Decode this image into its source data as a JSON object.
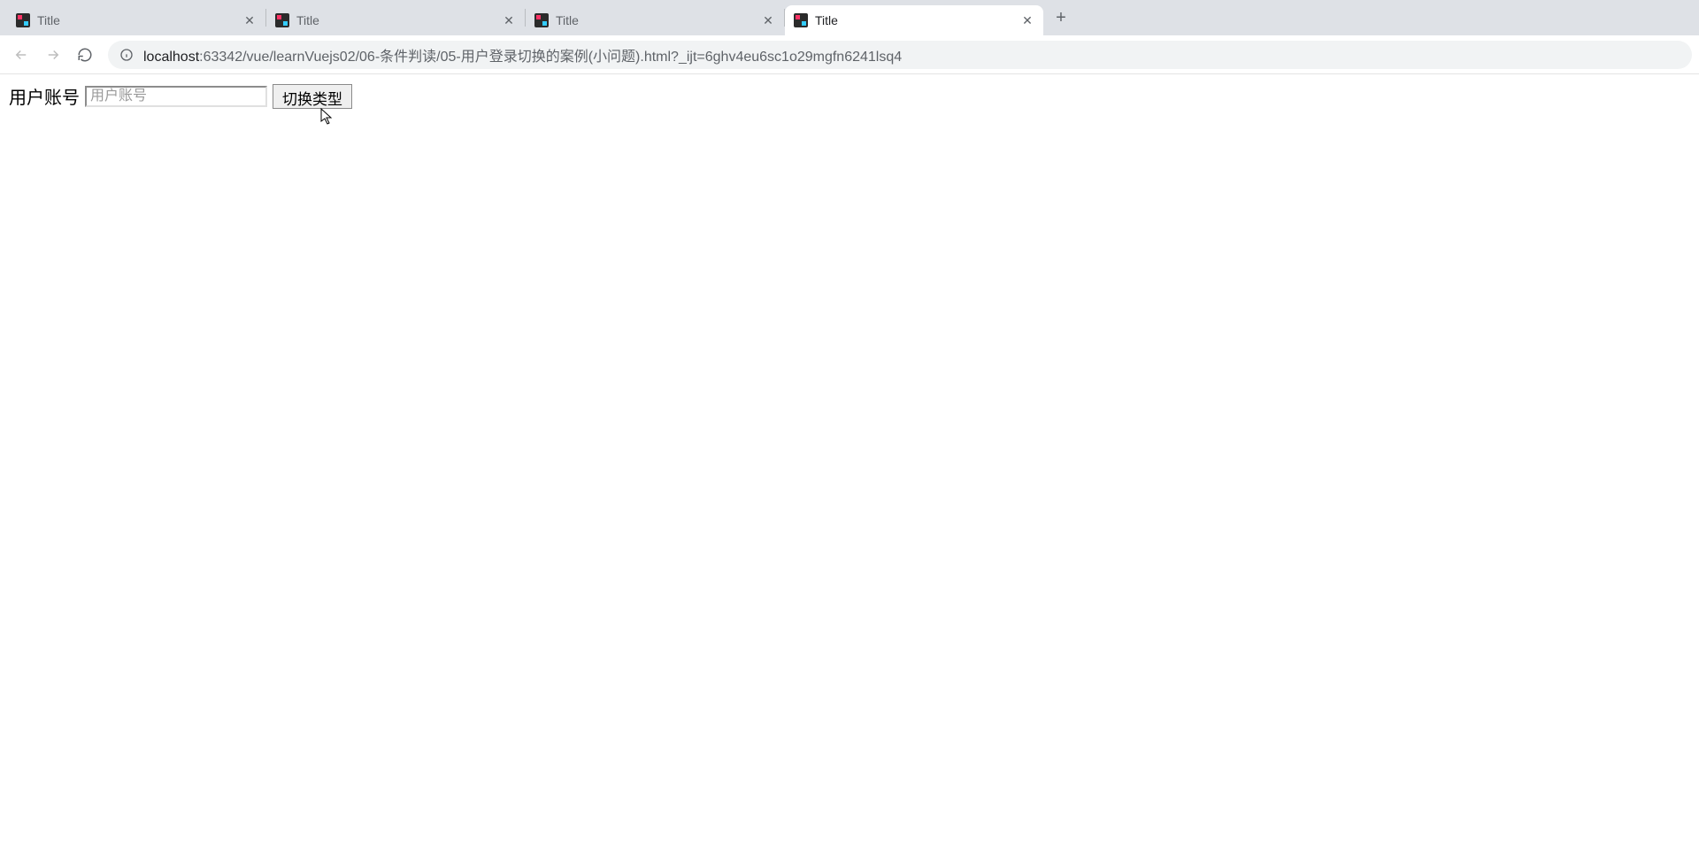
{
  "tabs": [
    {
      "title": "Title",
      "active": false
    },
    {
      "title": "Title",
      "active": false
    },
    {
      "title": "Title",
      "active": false
    },
    {
      "title": "Title",
      "active": true
    }
  ],
  "url": {
    "host": "localhost",
    "port_and_path": ":63342/vue/learnVuejs02/06-条件判读/05-用户登录切换的案例(小问题).html?_ijt=6ghv4eu6sc1o29mgfn6241lsq4"
  },
  "page": {
    "label": "用户账号",
    "placeholder": "用户账号",
    "button_label": "切换类型",
    "input_value": ""
  }
}
